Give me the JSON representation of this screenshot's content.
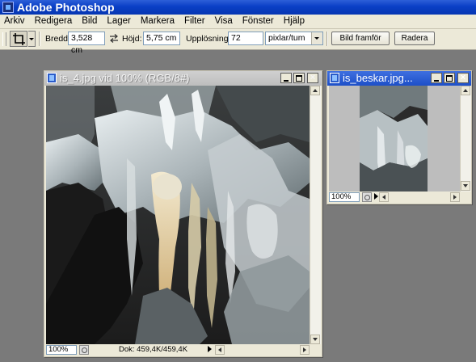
{
  "app": {
    "title": "Adobe Photoshop"
  },
  "menu": [
    "Arkiv",
    "Redigera",
    "Bild",
    "Lager",
    "Markera",
    "Filter",
    "Visa",
    "Fönster",
    "Hjälp"
  ],
  "options": {
    "width_label": "Bredd:",
    "width_value": "3,528 cm",
    "height_label": "Höjd:",
    "height_value": "5,75 cm",
    "resolution_label": "Upplösning:",
    "resolution_value": "72",
    "unit_value": "pixlar/tum",
    "front_image_button": "Bild framför",
    "clear_button": "Radera"
  },
  "windows": {
    "main": {
      "title": "is_4.jpg vid 100% (RGB/8#)",
      "zoom": "100%",
      "doc_info": "Dok: 459,4K/459,4K"
    },
    "side": {
      "title": "is_beskar.jpg...",
      "zoom": "100%"
    }
  },
  "colors": {
    "active_titlebar": "#1d4fc8",
    "inactive_titlebar": "#bdbdbd",
    "workspace": "#7a7a7a",
    "chrome": "#ece9d8"
  },
  "icons": [
    "photoshop-logo-icon",
    "crop-tool-icon",
    "swap-arrows-icon",
    "document-icon",
    "minimize-icon",
    "maximize-icon",
    "close-icon"
  ]
}
